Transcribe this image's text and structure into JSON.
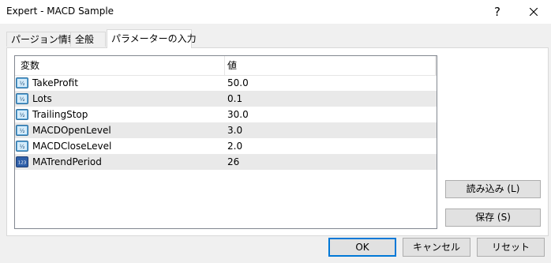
{
  "window": {
    "title": "Expert - MACD Sample",
    "help_glyph": "?"
  },
  "tabs": [
    {
      "label": "パージョン情報"
    },
    {
      "label": "全般"
    },
    {
      "label": "パラメーターの入力",
      "active": true
    }
  ],
  "grid": {
    "columns": {
      "name": "変数",
      "value": "値"
    },
    "rows": [
      {
        "icon": "double-value-icon",
        "name": "TakeProfit",
        "value": "50.0"
      },
      {
        "icon": "double-value-icon",
        "name": "Lots",
        "value": "0.1"
      },
      {
        "icon": "double-value-icon",
        "name": "TrailingStop",
        "value": "30.0"
      },
      {
        "icon": "double-value-icon",
        "name": "MACDOpenLevel",
        "value": "3.0"
      },
      {
        "icon": "double-value-icon",
        "name": "MACDCloseLevel",
        "value": "2.0"
      },
      {
        "icon": "integer-value-icon",
        "name": "MATrendPeriod",
        "value": "26"
      }
    ]
  },
  "buttons": {
    "load": "読み込み (L)",
    "save": "保存 (S)",
    "ok": "OK",
    "cancel": "キャンセル",
    "reset": "リセット"
  },
  "colors": {
    "accent": "#0078d7",
    "alt_row": "#e9e9e9",
    "icon_double": "#5fa8d8",
    "icon_integer": "#2f5fa8"
  }
}
